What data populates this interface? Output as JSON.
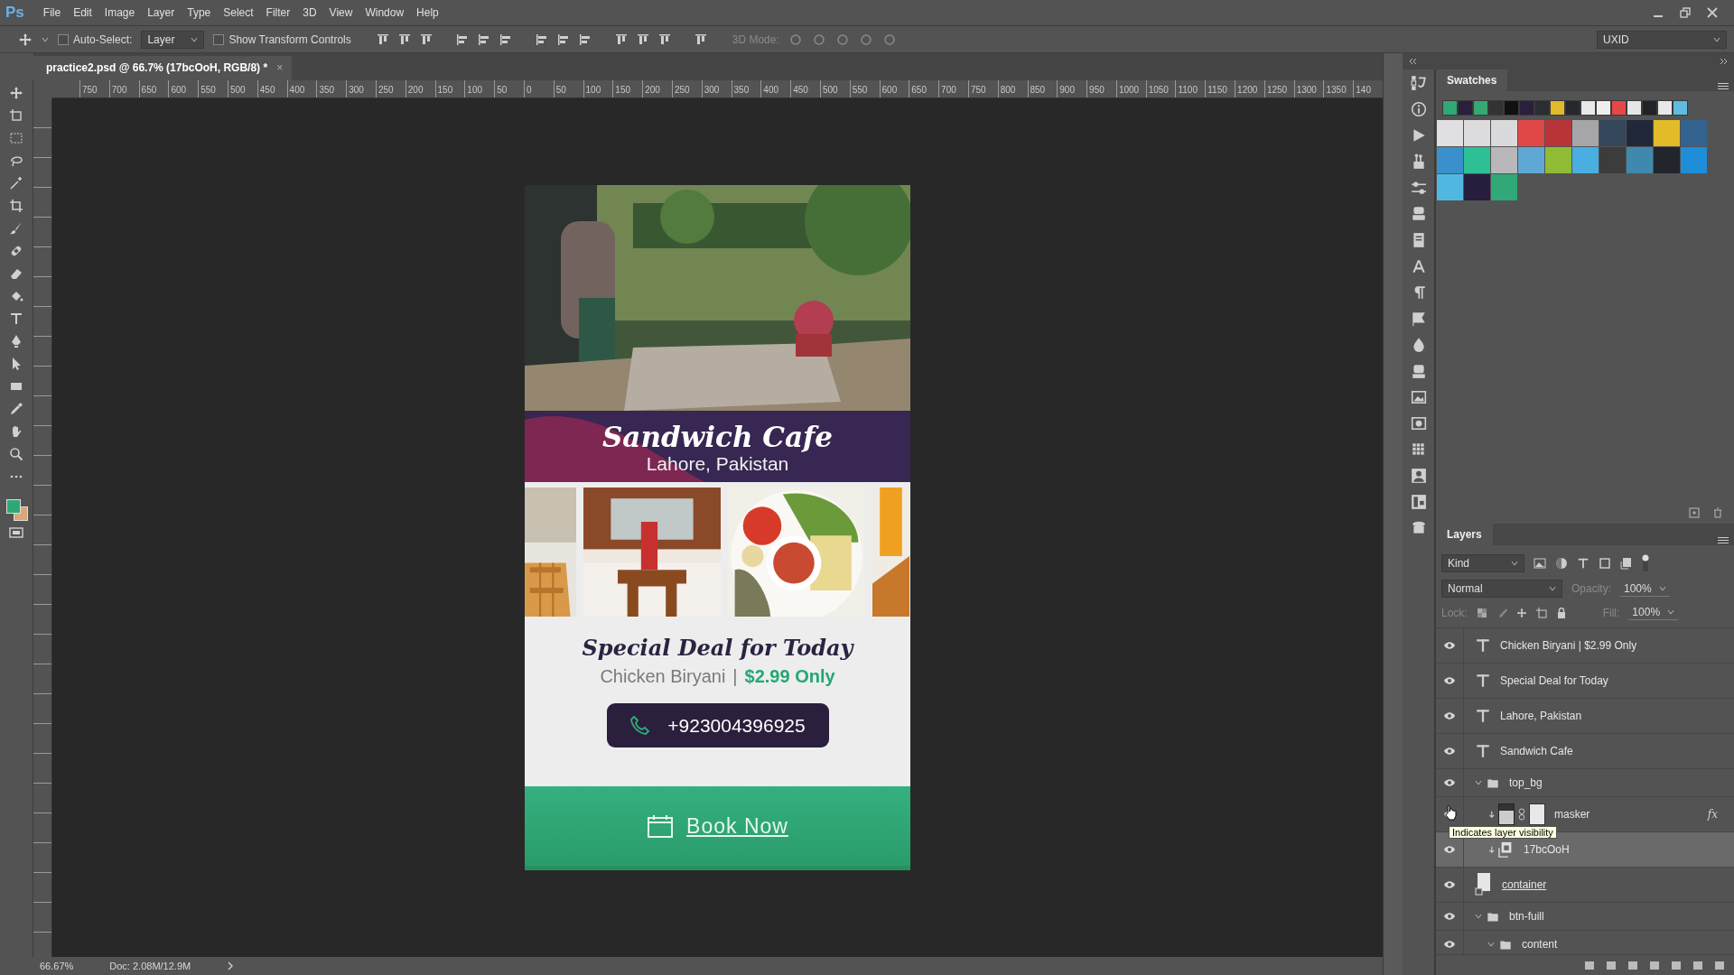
{
  "app": {
    "logo": "Ps"
  },
  "menu": [
    "File",
    "Edit",
    "Image",
    "Layer",
    "Type",
    "Select",
    "Filter",
    "3D",
    "View",
    "Window",
    "Help"
  ],
  "options_bar": {
    "auto_select": {
      "label": "Auto-Select:",
      "checked": false
    },
    "target": "Layer",
    "transform_controls": {
      "label": "Show Transform Controls",
      "checked": false
    },
    "mode_label": "3D Mode:",
    "workspace": "UXID"
  },
  "document_tab": {
    "title": "practice2.psd @ 66.7% (17bcOoH, RGB/8) *",
    "close": "×"
  },
  "ruler": [
    "750",
    "700",
    "650",
    "600",
    "550",
    "500",
    "450",
    "400",
    "350",
    "300",
    "250",
    "200",
    "150",
    "100",
    "50",
    "0",
    "50",
    "100",
    "150",
    "200",
    "250",
    "300",
    "350",
    "400",
    "450",
    "500",
    "550",
    "600",
    "650",
    "700",
    "750",
    "800",
    "850",
    "900",
    "950",
    "1000",
    "1050",
    "1100",
    "1150",
    "1200",
    "1250",
    "1300",
    "1350",
    "140"
  ],
  "canvas": {
    "title": "Sandwich Cafe",
    "location": "Lahore, Pakistan",
    "deal_title": "Special Deal for Today",
    "dish": "Chicken Biryani",
    "separator": "|",
    "price": "$2.99 Only",
    "phone": "+923004396925",
    "book": "Book Now"
  },
  "swatches": {
    "title": "Swatches",
    "recent": [
      {
        "color": "#2fa876"
      },
      {
        "color": "#2a1f3c"
      },
      {
        "color": "#35a874"
      },
      {
        "color": "#333333"
      },
      {
        "color": "#111111"
      },
      {
        "color": "#2b1f3f"
      },
      {
        "color": "#2b2d33"
      },
      {
        "color": "#e1b92a"
      },
      {
        "color": "#25282c"
      },
      {
        "color": "#e8e8e8"
      },
      {
        "color": "#eeeeee"
      },
      {
        "color": "#e54848"
      },
      {
        "color": "#e6e6e6"
      },
      {
        "color": "#1f2226"
      },
      {
        "color": "#e8e8e8"
      },
      {
        "color": "#5fbbe0"
      }
    ],
    "items": [
      {
        "color": "#e0e0e2"
      },
      {
        "color": "#dcdcde"
      },
      {
        "color": "#dadadc"
      },
      {
        "color": "#e04848"
      },
      {
        "color": "#b83438"
      },
      {
        "color": "#a6a6a8"
      },
      {
        "color": "#34465a"
      },
      {
        "color": "#20283a"
      },
      {
        "color": "#e2bc28"
      },
      {
        "color": "#34628e"
      },
      {
        "color": "#3a90cc"
      },
      {
        "color": "#2fbf94"
      },
      {
        "color": "#b8b8ba"
      },
      {
        "color": "#5fa8d4"
      },
      {
        "color": "#8fbc34"
      },
      {
        "color": "#4aaee0"
      },
      {
        "color": "#3c3c3c"
      },
      {
        "color": "#3f88ae"
      },
      {
        "color": "#22262c"
      },
      {
        "color": "#1e8ed8"
      },
      {
        "color": "#50b8e0"
      },
      {
        "color": "#261e3c"
      },
      {
        "color": "#30a878"
      }
    ]
  },
  "layers_panel": {
    "title": "Layers",
    "filter": "Kind",
    "blend_mode": "Normal",
    "opacity_label": "Opacity:",
    "opacity": "100%",
    "lock_label": "Lock:",
    "fill_label": "Fill:",
    "fill": "100%",
    "tooltip": "Indicates layer visibility",
    "layers": [
      {
        "kind": "text",
        "name": "Chicken Biryani | $2.99 Only",
        "visible": true,
        "selected": false
      },
      {
        "kind": "text",
        "name": "Special Deal for Today",
        "visible": true,
        "selected": false
      },
      {
        "kind": "text",
        "name": "Lahore, Pakistan",
        "visible": true,
        "selected": false
      },
      {
        "kind": "text",
        "name": "Sandwich Cafe",
        "visible": true,
        "selected": false
      },
      {
        "kind": "group",
        "name": "top_bg",
        "visible": true,
        "selected": false,
        "expanded": true,
        "children": [
          {
            "kind": "masked",
            "name": "masker",
            "visible": true,
            "selected": false,
            "effects": "fx"
          },
          {
            "kind": "smart",
            "name": "17bcOoH",
            "visible": true,
            "selected": true
          }
        ]
      },
      {
        "kind": "shape",
        "name": "container",
        "visible": true,
        "selected": false,
        "linked": true
      },
      {
        "kind": "group",
        "name": "btn-fuill",
        "visible": true,
        "selected": false,
        "expanded": true,
        "children": [
          {
            "kind": "group",
            "name": "content",
            "visible": true,
            "selected": false,
            "expanded": true
          }
        ]
      }
    ]
  },
  "status_bar": {
    "zoom": "66.67%",
    "doc": "Doc: 2.08M/12.9M"
  }
}
